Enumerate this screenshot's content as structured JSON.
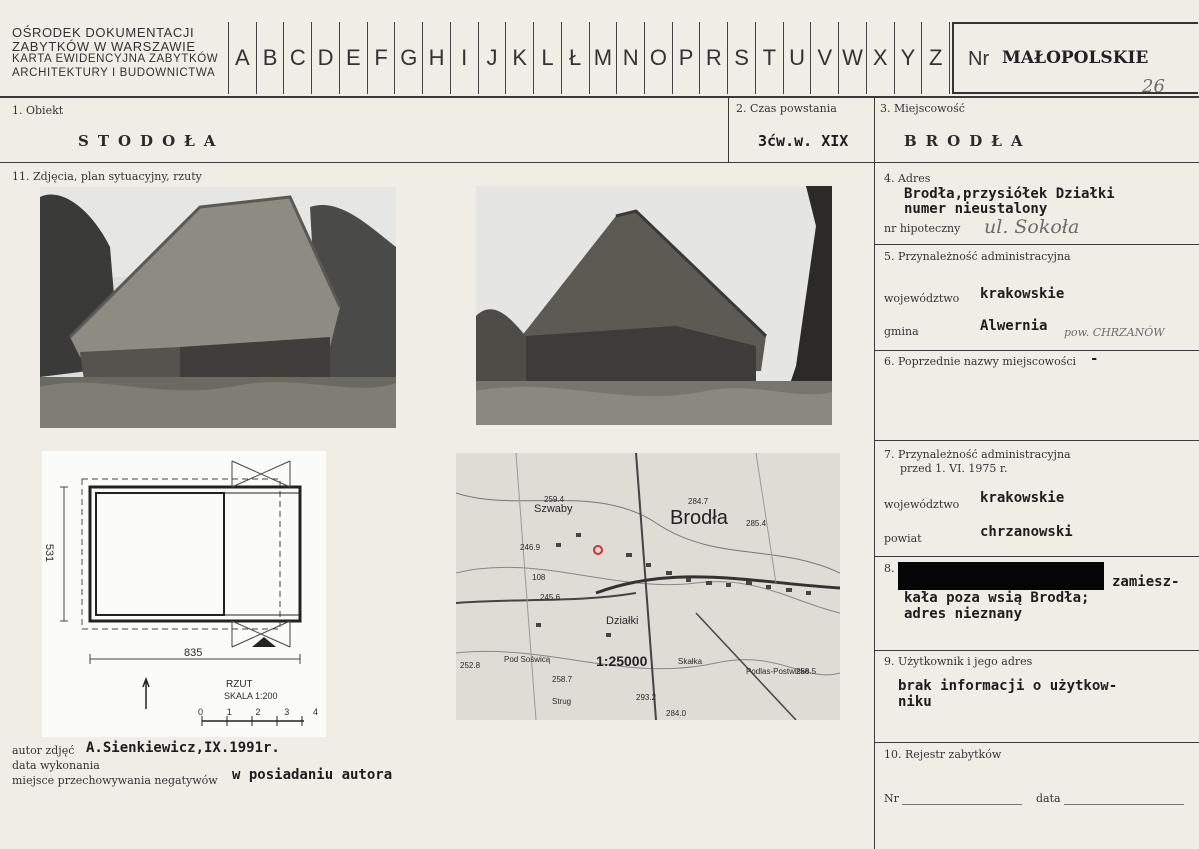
{
  "header": {
    "org_lines": [
      "OŚRODEK DOKUMENTACJI",
      "ZABYTKÓW W WARSZAWIE",
      "KARTA EWIDENCYJNA ZABYTKÓW",
      "ARCHITEKTURY I BUDOWNICTWA"
    ],
    "letters": [
      "A",
      "B",
      "C",
      "D",
      "E",
      "F",
      "G",
      "H",
      "I",
      "J",
      "K",
      "L",
      "Ł",
      "M",
      "N",
      "O",
      "P",
      "R",
      "S",
      "T",
      "U",
      "V",
      "W",
      "X",
      "Y",
      "Z"
    ],
    "nr_label": "Nr",
    "nr_value": "MAŁOPOLSKIE",
    "nr_number": "26"
  },
  "fields": {
    "obiekt_label": "1. Obiekt",
    "obiekt_value": "STODOŁA",
    "czas_label": "2. Czas powstania",
    "czas_value": "3ćw.w. XIX",
    "miejscowosc_label": "3. Miejscowość",
    "miejscowosc_value": "BRODŁA",
    "zdjecia_label": "11. Zdjęcia, plan sytuacyjny, rzuty",
    "adres_label": "4. Adres",
    "adres_value_1": "Brodła,przysiółek Działki",
    "adres_value_2": "numer nieustalony",
    "hipoteczny_label": "nr hipoteczny",
    "hipoteczny_value": "ul. Sokoła",
    "przynal_label": "5. Przynależność administracyjna",
    "wojewodztwo_label": "województwo",
    "wojewodztwo_value": "krakowskie",
    "gmina_label": "gmina",
    "gmina_value": "Alwernia",
    "gmina_note": "pow. CHRZANÓW",
    "poprzednie_label": "6. Poprzednie nazwy miejscowości",
    "poprzednie_value": "-",
    "przynal75_label_1": "7. Przynależność administracyjna",
    "przynal75_label_2": "przed 1. VI. 1975 r.",
    "wojewodztwo2_label": "województwo",
    "wojewodztwo2_value": "krakowskie",
    "powiat_label": "powiat",
    "powiat_value": "chrzanowski",
    "wlasciciel_label": "8.",
    "wlasciciel_value_1": "zamiesz-",
    "wlasciciel_value_2": "kała poza wsią Brodła;",
    "wlasciciel_value_3": "adres nieznany",
    "uzytkownik_label": "9. Użytkownik i jego adres",
    "uzytkownik_value_1": "brak informacji o użytkow-",
    "uzytkownik_value_2": "niku",
    "rejestr_label": "10. Rejestr zabytków",
    "rejestr_nr_label": "Nr",
    "rejestr_data_label": "data"
  },
  "footer": {
    "autor_label": "autor zdjęć",
    "autor_value": "A.Sienkiewicz,IX.1991r.",
    "data_label": "data wykonania",
    "miejsce_label": "miejsce przechowywania negatywów",
    "miejsce_value": "w posiadaniu autora"
  },
  "plan": {
    "dim_side": "531",
    "dim_bottom": "835",
    "title": "RZUT",
    "scale": "SKALA 1:200",
    "ticks": [
      "0",
      "1",
      "2",
      "3",
      "4"
    ]
  },
  "map": {
    "place": "Brodła",
    "scale": "1:25000",
    "labels": [
      "Szwaby",
      "Działki",
      "Pod Soświcą",
      "Skałka",
      "Podlas-Postwisko",
      "Strug"
    ],
    "heights": [
      "259.4",
      "284.7",
      "285.4",
      "246.9",
      "245.6",
      "252.8",
      "258.7",
      "293.2",
      "284.0",
      "258.5",
      "108"
    ]
  }
}
